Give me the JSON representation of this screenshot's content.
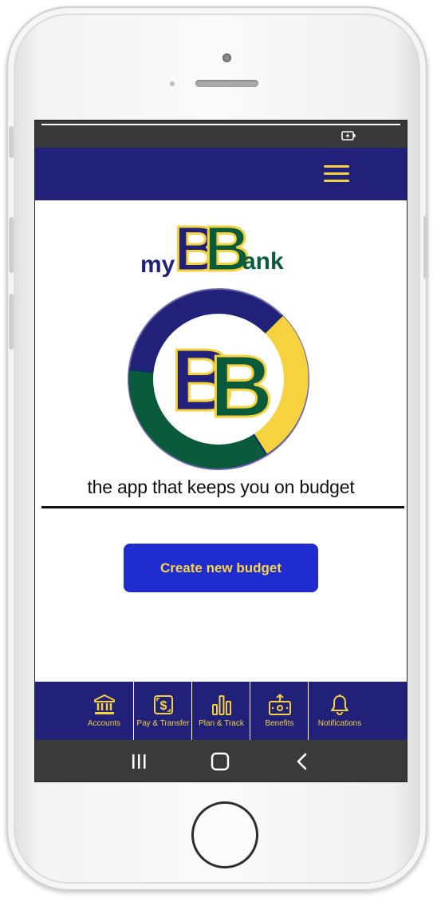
{
  "app": {
    "logo": {
      "prefix": "my",
      "letters": "BB",
      "suffix": "ank"
    },
    "tagline": "the app that keeps you on budget",
    "cta_label": "Create new budget"
  },
  "status_bar": {
    "battery_icon": "battery-charging-icon"
  },
  "app_bar": {
    "menu_icon": "hamburger-menu-icon"
  },
  "bottom_nav": [
    {
      "label": "Accounts",
      "icon": "bank-icon"
    },
    {
      "label": "Pay & Transfer",
      "icon": "dollar-transfer-icon"
    },
    {
      "label": "Plan & Track",
      "icon": "bar-chart-icon"
    },
    {
      "label": "Benefits",
      "icon": "gift-card-icon"
    },
    {
      "label": "Notifications",
      "icon": "bell-icon"
    }
  ],
  "system_nav": [
    {
      "icon": "recent-apps-icon"
    },
    {
      "icon": "home-icon"
    },
    {
      "icon": "back-icon"
    }
  ],
  "colors": {
    "navy": "#21217a",
    "gold": "#f6d23f",
    "green": "#0a5a3c",
    "button_blue": "#1f2ccf",
    "status_gray": "#393939"
  }
}
